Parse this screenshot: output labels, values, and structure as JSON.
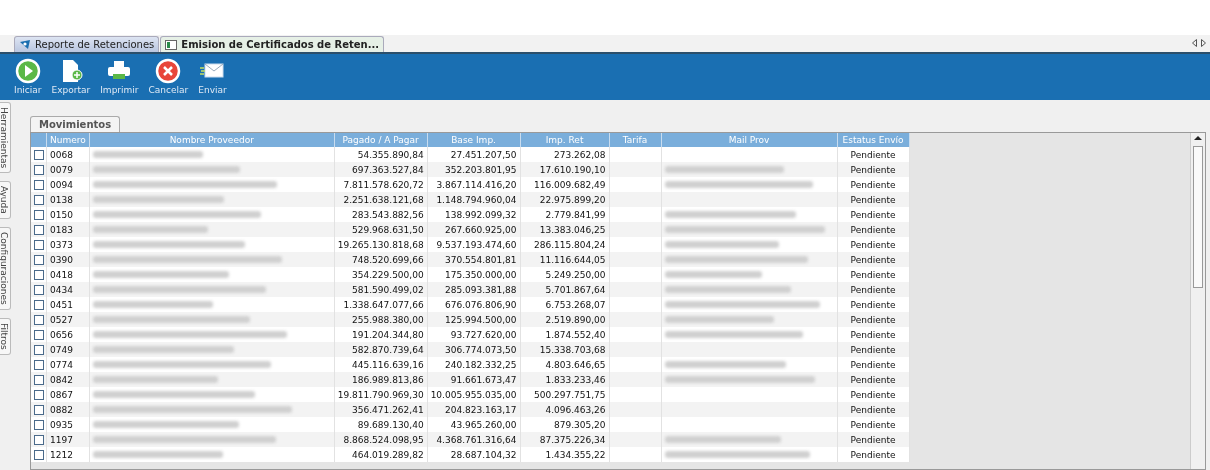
{
  "tabs": [
    {
      "label": "Reporte de Retenciones",
      "selected": false,
      "kind": "report"
    },
    {
      "label": "Emision de Certificados de Reten...",
      "selected": true,
      "kind": "form"
    }
  ],
  "toolbar": [
    {
      "label": "Iniciar",
      "kind": "start"
    },
    {
      "label": "Exportar",
      "kind": "export"
    },
    {
      "label": "Imprimir",
      "kind": "print"
    },
    {
      "label": "Cancelar",
      "kind": "cancel"
    },
    {
      "label": "Enviar",
      "kind": "send"
    }
  ],
  "side_tabs": [
    "Herramientas",
    "Ayuda",
    "Configuraciones",
    "Filtros"
  ],
  "panel_tab": {
    "label": "Movimientos",
    "selected": true
  },
  "table": {
    "columns": [
      "Numero",
      "Nombre Proveedor",
      "Pagado / A Pagar",
      "Base Imp.",
      "Imp. Ret",
      "Tarifa",
      "Mail Prov",
      "Estatus Envío"
    ],
    "rows": [
      {
        "checked": false,
        "numero": "0068",
        "pagado": "54.355.890,84",
        "base": "27.451.207,50",
        "ret": "273.262,08",
        "has_mail": false,
        "estatus": "Pendiente"
      },
      {
        "checked": false,
        "numero": "0079",
        "pagado": "697.363.527,84",
        "base": "352.203.801,95",
        "ret": "17.610.190,10",
        "has_mail": true,
        "estatus": "Pendiente"
      },
      {
        "checked": false,
        "numero": "0094",
        "pagado": "7.811.578.620,72",
        "base": "3.867.114.416,20",
        "ret": "116.009.682,49",
        "has_mail": true,
        "estatus": "Pendiente"
      },
      {
        "checked": false,
        "numero": "0138",
        "pagado": "2.251.638.121,68",
        "base": "1.148.794.960,04",
        "ret": "22.975.899,20",
        "has_mail": false,
        "estatus": "Pendiente"
      },
      {
        "checked": false,
        "numero": "0150",
        "pagado": "283.543.882,56",
        "base": "138.992.099,32",
        "ret": "2.779.841,99",
        "has_mail": true,
        "estatus": "Pendiente"
      },
      {
        "checked": false,
        "numero": "0183",
        "pagado": "529.968.631,50",
        "base": "267.660.925,00",
        "ret": "13.383.046,25",
        "has_mail": true,
        "estatus": "Pendiente"
      },
      {
        "checked": false,
        "numero": "0373",
        "pagado": "19.265.130.818,68",
        "base": "9.537.193.474,60",
        "ret": "286.115.804,24",
        "has_mail": true,
        "estatus": "Pendiente"
      },
      {
        "checked": false,
        "numero": "0390",
        "pagado": "748.520.699,66",
        "base": "370.554.801,81",
        "ret": "11.116.644,05",
        "has_mail": true,
        "estatus": "Pendiente"
      },
      {
        "checked": false,
        "numero": "0418",
        "pagado": "354.229.500,00",
        "base": "175.350.000,00",
        "ret": "5.249.250,00",
        "has_mail": true,
        "estatus": "Pendiente"
      },
      {
        "checked": false,
        "numero": "0434",
        "pagado": "581.590.499,02",
        "base": "285.093.381,88",
        "ret": "5.701.867,64",
        "has_mail": true,
        "estatus": "Pendiente"
      },
      {
        "checked": false,
        "numero": "0451",
        "pagado": "1.338.647.077,66",
        "base": "676.076.806,90",
        "ret": "6.753.268,07",
        "has_mail": true,
        "estatus": "Pendiente"
      },
      {
        "checked": false,
        "numero": "0527",
        "pagado": "255.988.380,00",
        "base": "125.994.500,00",
        "ret": "2.519.890,00",
        "has_mail": true,
        "estatus": "Pendiente"
      },
      {
        "checked": false,
        "numero": "0656",
        "pagado": "191.204.344,80",
        "base": "93.727.620,00",
        "ret": "1.874.552,40",
        "has_mail": true,
        "estatus": "Pendiente"
      },
      {
        "checked": false,
        "numero": "0749",
        "pagado": "582.870.739,64",
        "base": "306.774.073,50",
        "ret": "15.338.703,68",
        "has_mail": false,
        "estatus": "Pendiente"
      },
      {
        "checked": false,
        "numero": "0774",
        "pagado": "445.116.639,16",
        "base": "240.182.332,25",
        "ret": "4.803.646,65",
        "has_mail": true,
        "estatus": "Pendiente"
      },
      {
        "checked": false,
        "numero": "0842",
        "pagado": "186.989.813,86",
        "base": "91.661.673,47",
        "ret": "1.833.233,46",
        "has_mail": true,
        "estatus": "Pendiente"
      },
      {
        "checked": false,
        "numero": "0867",
        "pagado": "19.811.790.969,30",
        "base": "10.005.955.035,00",
        "ret": "500.297.751,75",
        "has_mail": false,
        "estatus": "Pendiente"
      },
      {
        "checked": false,
        "numero": "0882",
        "pagado": "356.471.262,41",
        "base": "204.823.163,17",
        "ret": "4.096.463,26",
        "has_mail": false,
        "estatus": "Pendiente"
      },
      {
        "checked": false,
        "numero": "0935",
        "pagado": "89.689.130,40",
        "base": "43.965.260,00",
        "ret": "879.305,20",
        "has_mail": false,
        "estatus": "Pendiente"
      },
      {
        "checked": false,
        "numero": "1197",
        "pagado": "8.868.524.098,95",
        "base": "4.368.761.316,64",
        "ret": "87.375.226,34",
        "has_mail": true,
        "estatus": "Pendiente"
      },
      {
        "checked": false,
        "numero": "1212",
        "pagado": "464.019.289,82",
        "base": "28.687.104,32",
        "ret": "1.434.355,22",
        "has_mail": true,
        "estatus": "Pendiente"
      }
    ]
  }
}
